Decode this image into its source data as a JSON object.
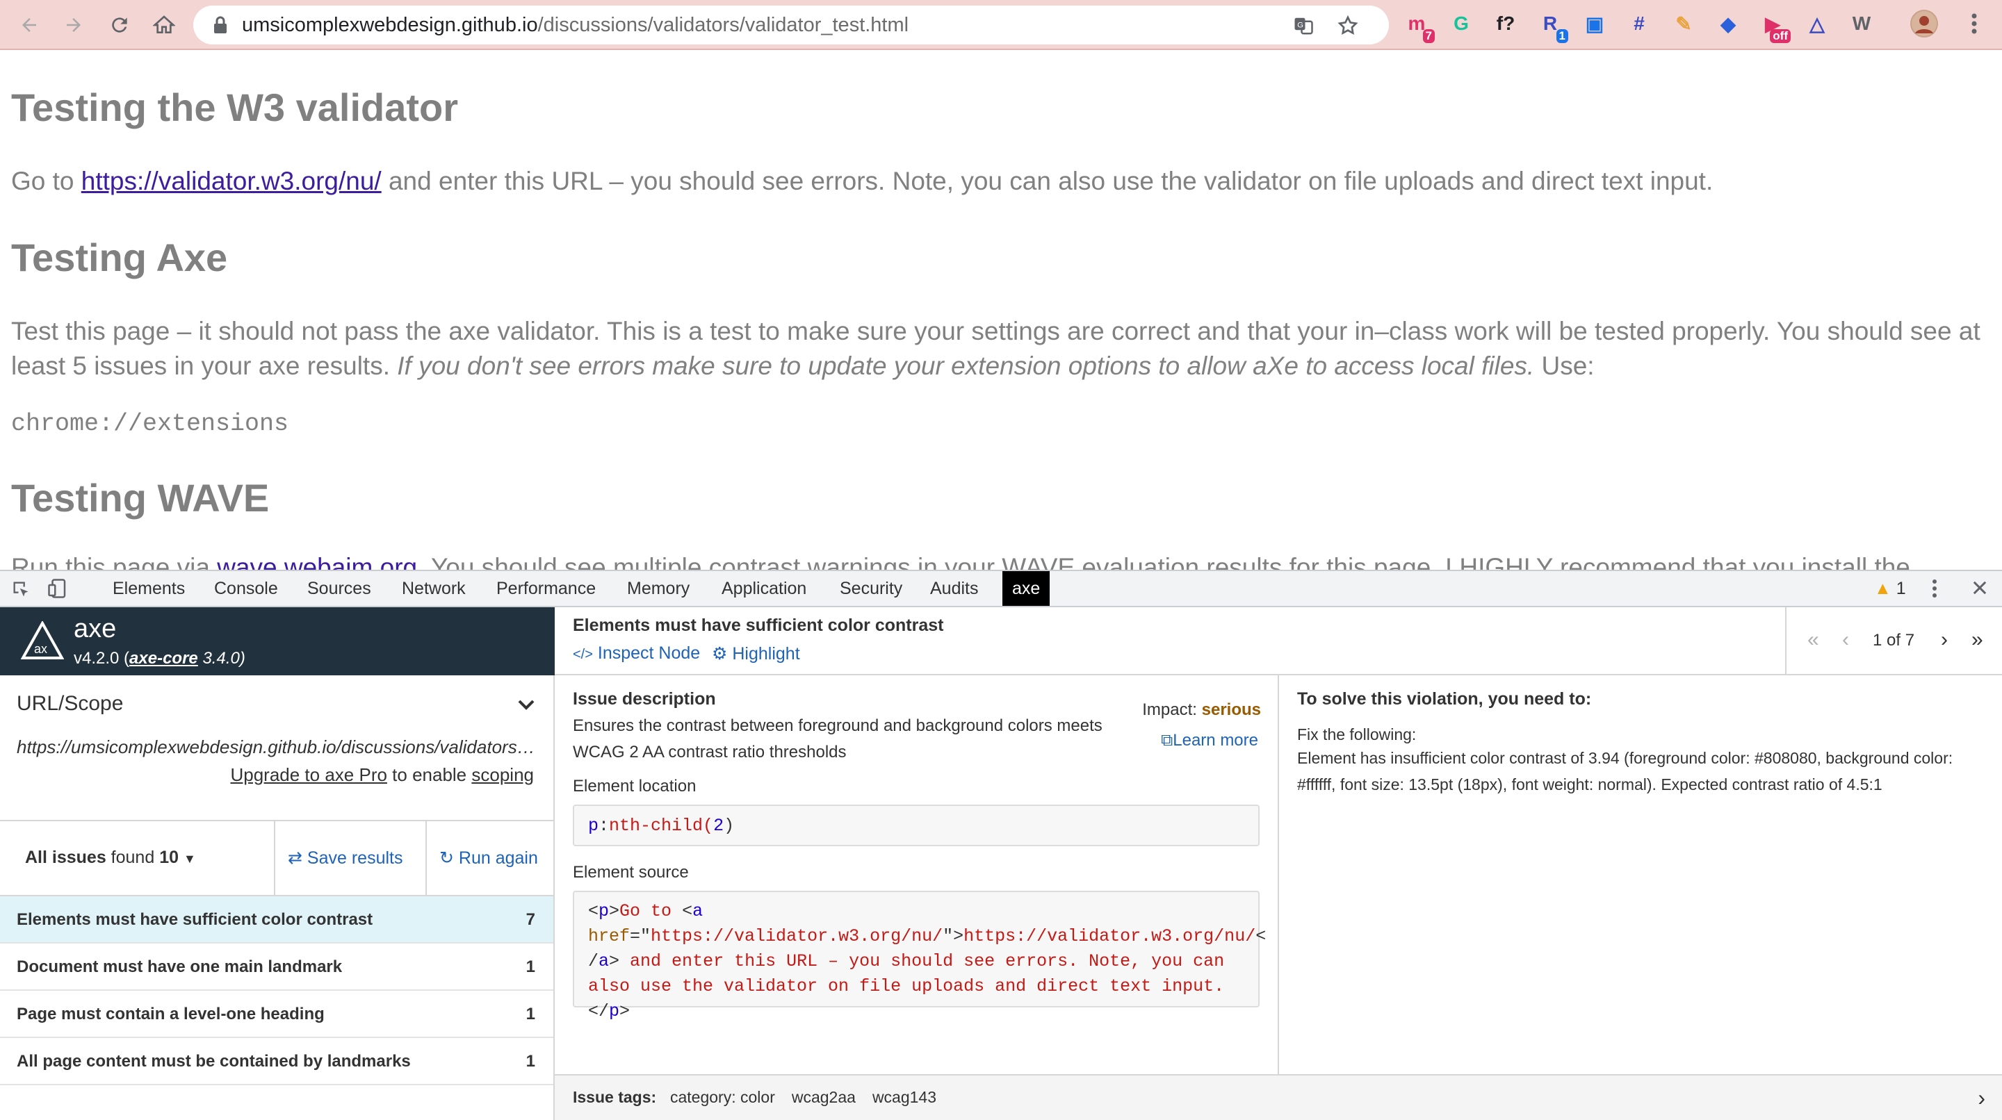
{
  "browser": {
    "url_host": "umsicomplexwebdesign.github.io",
    "url_path": "/discussions/validators/validator_test.html",
    "extensions": [
      {
        "icon": "m-extension-icon",
        "glyph": "m",
        "badge": "7",
        "color": "#e0306a"
      },
      {
        "icon": "grammarly-icon",
        "glyph": "G",
        "badge": "",
        "color": "#15c39a"
      },
      {
        "icon": "formula-icon",
        "glyph": "f?",
        "badge": "",
        "color": "#202124"
      },
      {
        "icon": "r-extension-icon",
        "glyph": "R",
        "badge": "1",
        "color": "#3b4cc0"
      },
      {
        "icon": "reader-icon",
        "glyph": "▣",
        "badge": "",
        "color": "#1a73e8"
      },
      {
        "icon": "crop-icon",
        "glyph": "#",
        "badge": "",
        "color": "#3b4cc0"
      },
      {
        "icon": "pencil-icon",
        "glyph": "✎",
        "badge": "",
        "color": "#e8a33d"
      },
      {
        "icon": "diamond-icon",
        "glyph": "◆",
        "badge": "",
        "color": "#2a60d9"
      },
      {
        "icon": "video-icon",
        "glyph": "▶",
        "badge": "off",
        "color": "#e0306a"
      },
      {
        "icon": "axe-extension-icon",
        "glyph": "△",
        "badge": "",
        "color": "#3b4cc0"
      },
      {
        "icon": "wave-extension-icon",
        "glyph": "W",
        "badge": "",
        "color": "#5f6368"
      }
    ]
  },
  "page": {
    "h_validator": "Testing the W3 validator",
    "p1_before": "Go to ",
    "p1_link": "https://validator.w3.org/nu/",
    "p1_after": " and enter this URL – you should see errors. Note, you can also use the validator on file uploads and direct text input.",
    "h_axe": "Testing Axe",
    "p2_text": "Test this page – it should not pass the axe validator. This is a test to make sure your settings are correct and that your in–class work will be tested properly. You should see at least 5 issues in your axe results. ",
    "p2_italic": "If you don't see errors make sure to update your extension options to allow aXe to access local files.",
    "p2_end": " Use:",
    "code": "chrome://extensions",
    "h_wave": "Testing WAVE",
    "p3_before": "Run this page via ",
    "p3_link": "wave.webaim.org",
    "p3_after": ". You should see multiple contrast warnings in your WAVE evaluation results for this page. I HIGHLY recommend that you install the"
  },
  "devtools": {
    "tabs": [
      "Elements",
      "Console",
      "Sources",
      "Network",
      "Performance",
      "Memory",
      "Application",
      "Security",
      "Audits",
      "axe"
    ],
    "active_tab": "axe",
    "warning_count": "1"
  },
  "axe": {
    "name": "axe",
    "version": "v4.2.0 (",
    "core_link": "axe-core",
    "core_version": " 3.4.0)",
    "scope_title": "URL/Scope",
    "scope_url": "https://umsicomplexwebdesign.github.io/discussions/validators/validator_test.html",
    "upgrade_link": "Upgrade to axe Pro",
    "upgrade_mid": " to enable ",
    "scoping_link": "scoping",
    "all_issues_label": "All issues",
    "found_label": " found ",
    "issue_total": "10",
    "save_results": "Save results",
    "run_again": "Run again",
    "issues": [
      {
        "label": "Elements must have sufficient color contrast",
        "count": "7"
      },
      {
        "label": "Document must have one main landmark",
        "count": "1"
      },
      {
        "label": "Page must contain a level-one heading",
        "count": "1"
      },
      {
        "label": "All page content must be contained by landmarks",
        "count": "1"
      }
    ],
    "detail": {
      "title": "Elements must have sufficient color contrast",
      "inspect_node": "Inspect Node",
      "highlight": "Highlight",
      "pager": "1 of 7",
      "issue_description_label": "Issue description",
      "issue_description": "Ensures the contrast between foreground and background colors meets WCAG 2 AA contrast ratio thresholds",
      "impact_label": "Impact: ",
      "impact_value": "serious",
      "learn_more": "Learn more",
      "element_location_label": "Element location",
      "element_location_kw": "p",
      "element_location_rest": "nth-child(",
      "element_location_num": "2",
      "element_source_label": "Element source",
      "solve_title": "To solve this violation, you need to:",
      "fix_label": "Fix the following:",
      "fix_text": "Element has insufficient color contrast of 3.94 (foreground color: #808080, background color: #ffffff, font size: 13.5pt (18px), font weight: normal). Expected contrast ratio of 4.5:1",
      "tags_label": "Issue tags:",
      "tags": [
        "category: color",
        "wcag2aa",
        "wcag143"
      ]
    }
  },
  "colors": {
    "page_text": "#808080",
    "link": "#3c1d9d",
    "axe_header": "#21313e",
    "impact_serious": "#9a5a00",
    "axe_link": "#1e63b8"
  }
}
